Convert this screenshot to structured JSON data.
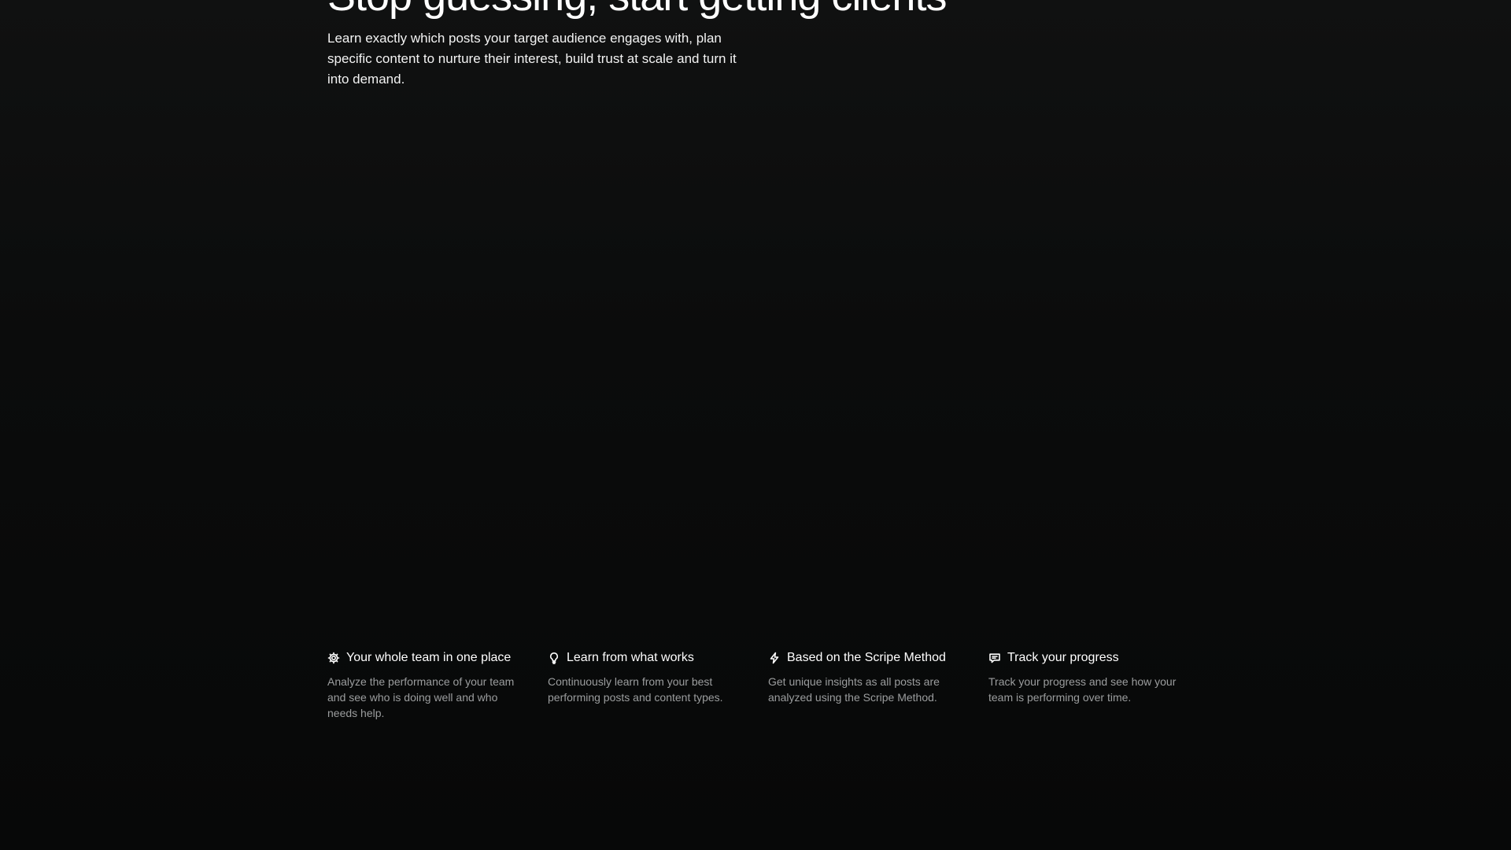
{
  "hero": {
    "title": "Stop guessing, start getting clients",
    "description": "Learn exactly which posts your target audience engages with, plan specific content to nurture their interest, build trust at scale and turn it into demand."
  },
  "features": [
    {
      "icon": "gear-icon",
      "title": "Your whole team in one place",
      "description": "Analyze the performance of your team and see who is doing well and who needs help."
    },
    {
      "icon": "lightbulb-icon",
      "title": "Learn from what works",
      "description": "Continuously learn from your best performing posts and content types."
    },
    {
      "icon": "lightning-icon",
      "title": "Based on the Scripe Method",
      "description": "Get unique insights as all posts are analyzed using the Scripe Method."
    },
    {
      "icon": "chat-icon",
      "title": "Track your progress",
      "description": "Track your progress and see how your team is performing over time."
    }
  ],
  "colors": {
    "background": "#0b0c0c",
    "text": "#ffffff",
    "muted_text": "#9b9d9e"
  }
}
